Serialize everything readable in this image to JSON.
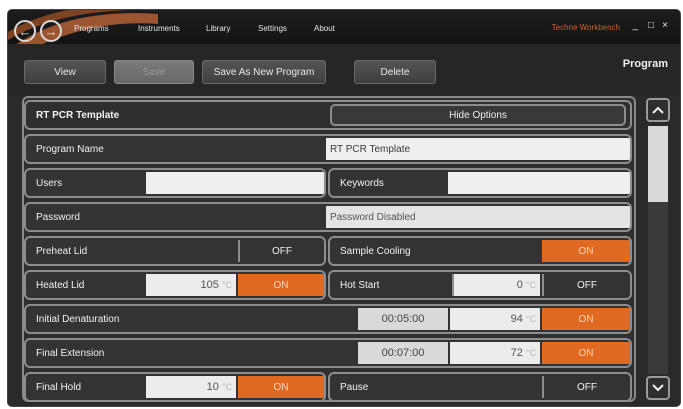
{
  "menubar": {
    "items": [
      "Programs",
      "Instruments",
      "Library",
      "Settings",
      "About"
    ],
    "app_title": "Techne Workbench",
    "window_controls": [
      "_",
      "□",
      "×"
    ]
  },
  "toolbar": {
    "view_label": "View",
    "save_label": "Save",
    "save_as_label": "Save As New Program",
    "delete_label": "Delete",
    "section_title": "Program"
  },
  "program": {
    "title": "RT PCR Template",
    "hide_options_label": "Hide Options",
    "fields": {
      "program_name_label": "Program Name",
      "program_name_value": "RT PCR Template",
      "users_label": "Users",
      "users_value": "",
      "keywords_label": "Keywords",
      "keywords_value": "",
      "password_label": "Password",
      "password_value": "Password Disabled"
    },
    "options": {
      "preheat_lid_label": "Preheat Lid",
      "preheat_lid_state": "OFF",
      "sample_cooling_label": "Sample Cooling",
      "sample_cooling_state": "ON",
      "heated_lid_label": "Heated Lid",
      "heated_lid_temp": "105",
      "heated_lid_state": "ON",
      "hot_start_label": "Hot Start",
      "hot_start_temp": "0",
      "hot_start_state": "OFF",
      "initial_denat_label": "Initial Denaturation",
      "initial_denat_time": "00:05:00",
      "initial_denat_temp": "94",
      "initial_denat_state": "ON",
      "final_ext_label": "Final Extension",
      "final_ext_time": "00:07:00",
      "final_ext_temp": "72",
      "final_ext_state": "ON",
      "final_hold_label": "Final Hold",
      "final_hold_temp": "10",
      "final_hold_state": "ON",
      "pause_label": "Pause",
      "pause_state": "OFF",
      "unit": "°C"
    }
  },
  "colors": {
    "accent": "#e06a22",
    "background": "#2a2a2a",
    "field": "#efefef"
  },
  "scroll": {
    "up": "^",
    "down": "v"
  }
}
